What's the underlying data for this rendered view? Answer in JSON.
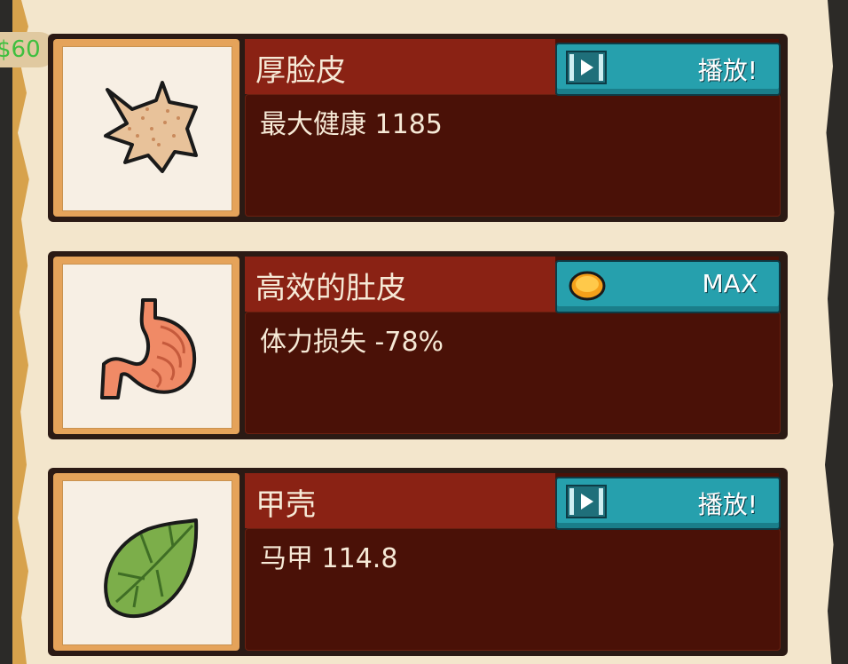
{
  "balance": "$60",
  "play_label": "播放!",
  "max_label": "MAX",
  "upgrades": [
    {
      "name": "厚脸皮",
      "stat": "最大健康 1185",
      "action": "play",
      "icon": "skin-icon"
    },
    {
      "name": "高效的肚皮",
      "stat": "体力损失 -78%",
      "action": "max",
      "icon": "stomach-icon"
    },
    {
      "name": "甲壳",
      "stat": "马甲 114.8",
      "action": "play",
      "icon": "shell-icon"
    }
  ],
  "colors": {
    "action_button": "#26a0ad",
    "title_bar": "#8a2214",
    "body_panel": "#4a1107",
    "coin": "#f5a01a",
    "balance_text": "#3fbf3f"
  }
}
